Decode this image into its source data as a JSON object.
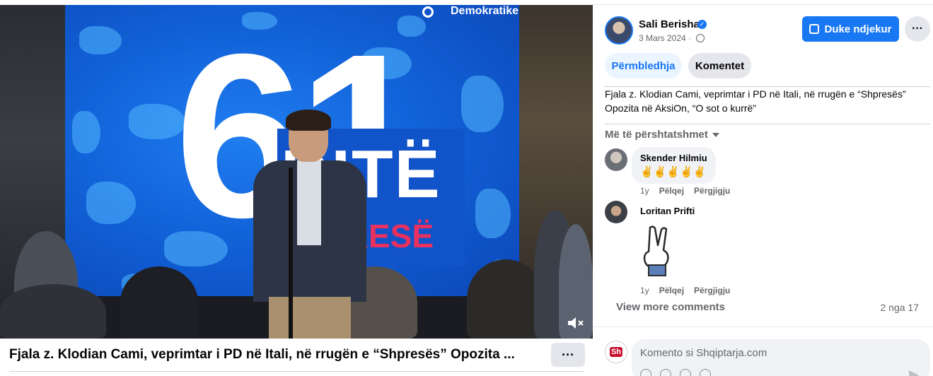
{
  "video": {
    "screen_number": "61",
    "screen_word_1": "DITË",
    "screen_word_2": "ORESË",
    "screen_brand": "Demokratike",
    "mute_icon": "volume-muted-icon",
    "title": "Fjala z. Klodian Cami, veprimtar i PD në Itali, në rrugën e “Shpresës” Opozita ...",
    "more_label": "···"
  },
  "post": {
    "author": "Sali Berisha",
    "date": "3 Mars 2024",
    "date_separator": "·",
    "follow_label": "Duke ndjekur",
    "more_label": "···",
    "caption": "Fjala z. Klodian Cami, veprimtar i PD në Itali, në rrugën e “Shpresës” Opozita në AksiOn, “O sot o kurrë”"
  },
  "tabs": {
    "summary": "Përmbledhja",
    "comments": "Komentet"
  },
  "comments": {
    "sort_label": "Më të përshtatshmet",
    "items": [
      {
        "author": "Skender Hilmiu",
        "text": "✌️✌️✌️✌️✌️",
        "time": "1y",
        "like": "Pëlqej",
        "reply": "Përgjigju"
      },
      {
        "author": "Loritan Prifti",
        "sticker": "victory-hand-sticker",
        "time": "1y",
        "like": "Pëlqej",
        "reply": "Përgjigju"
      }
    ],
    "view_more": "View more comments",
    "counter": "2 nga 17"
  },
  "composer": {
    "placeholder": "Komento si Shqiptarja.com",
    "avatar_text": "Sh"
  },
  "colors": {
    "accent": "#1877f2",
    "screen_blue": "#1262d8",
    "screen_red": "#e8315f"
  }
}
